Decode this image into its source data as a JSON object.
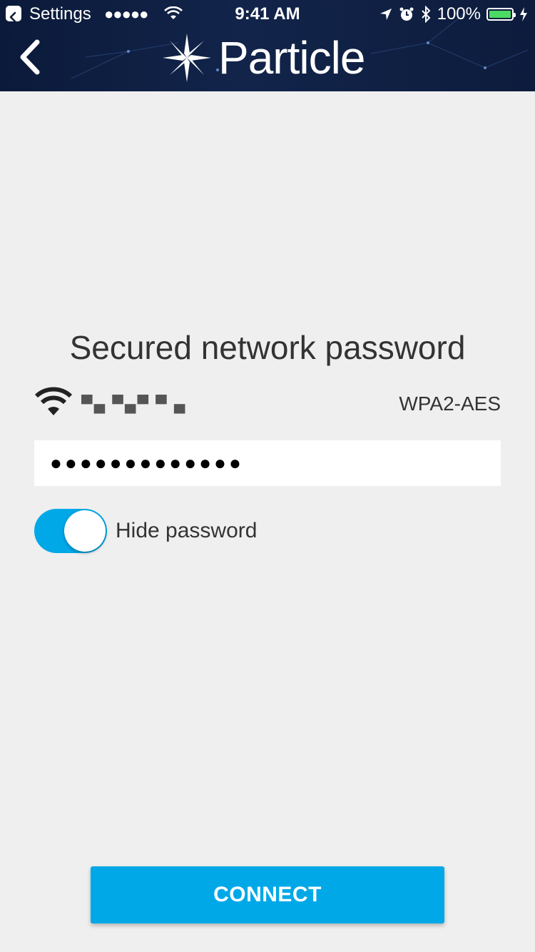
{
  "status_bar": {
    "back_app": "Settings",
    "signal": "●●●●●",
    "time": "9:41 AM",
    "battery": "100%",
    "battery_color": "#4cd964"
  },
  "header": {
    "logo_text": "Particle",
    "back_icon": "chevron-left-icon"
  },
  "screen": {
    "title": "Secured network password"
  },
  "network": {
    "ssid": "▀▄ ▀▄▀ ▀ ▄",
    "security": "WPA2-AES",
    "icon": "wifi-icon"
  },
  "password_field": {
    "value": "●●●●●●●●●●●●●"
  },
  "hide_password": {
    "label": "Hide password",
    "enabled": true,
    "color": "#00a8e8"
  },
  "connect_button": {
    "label": "CONNECT",
    "color": "#00a8e8"
  }
}
